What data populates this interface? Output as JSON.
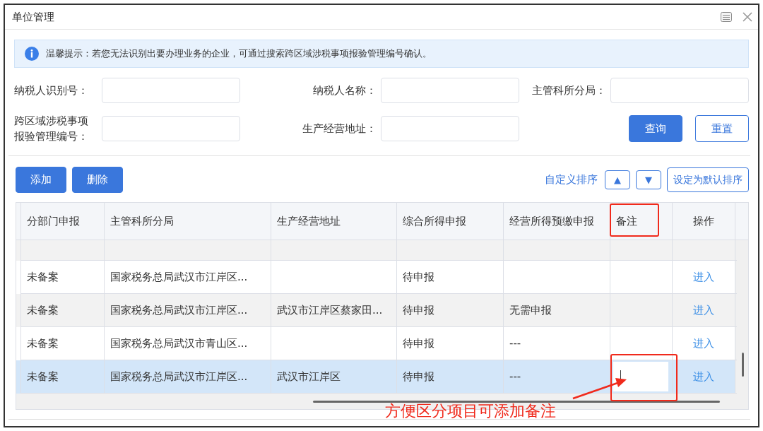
{
  "window": {
    "title": "单位管理"
  },
  "notice": "温馨提示：若您无法识别出要办理业务的企业，可通过搜索跨区域涉税事项报验管理编号确认。",
  "filters": [
    {
      "label": "纳税人识别号："
    },
    {
      "label": "纳税人名称："
    },
    {
      "label": "主管科所分局："
    },
    {
      "label": "跨区域涉税事项报验管理编号："
    },
    {
      "label": "生产经营地址："
    }
  ],
  "search_buttons": [
    {
      "label": "查询",
      "kind": "primary"
    },
    {
      "label": "重置",
      "kind": "outline"
    }
  ],
  "actions": [
    "添加",
    "删除"
  ],
  "sort": {
    "label": "自定义排序",
    "up": "▲",
    "down": "▼",
    "default": "设定为默认排序"
  },
  "table": {
    "columns": [
      "分部门申报",
      "主管科所分局",
      "生产经营地址",
      "综合所得申报",
      "经营所得预缴申报",
      "备注",
      "操作"
    ],
    "rows": [
      {
        "selected": false,
        "dept": "未备案",
        "office": "国家税务总局武汉市江岸区...",
        "income": "待申报",
        "action": "进入"
      },
      {
        "selected": false,
        "dept": "未备案",
        "office": "国家税务总局武汉市江岸区...",
        "address": "武汉市江岸区蔡家田...",
        "income": "待申报",
        "business": "无需申报",
        "action": "进入"
      },
      {
        "selected": false,
        "dept": "未备案",
        "office": "国家税务总局武汉市青山区...",
        "income": "待申报",
        "business": "---",
        "action": "进入"
      },
      {
        "selected": true,
        "editing": true,
        "dept": "未备案",
        "office": "国家税务总局武汉市江岸区...",
        "address": "武汉市江岸区",
        "income": "待申报",
        "business": "---",
        "action": "进入"
      }
    ]
  },
  "annotation": {
    "text": "方便区分项目可添加备注"
  }
}
